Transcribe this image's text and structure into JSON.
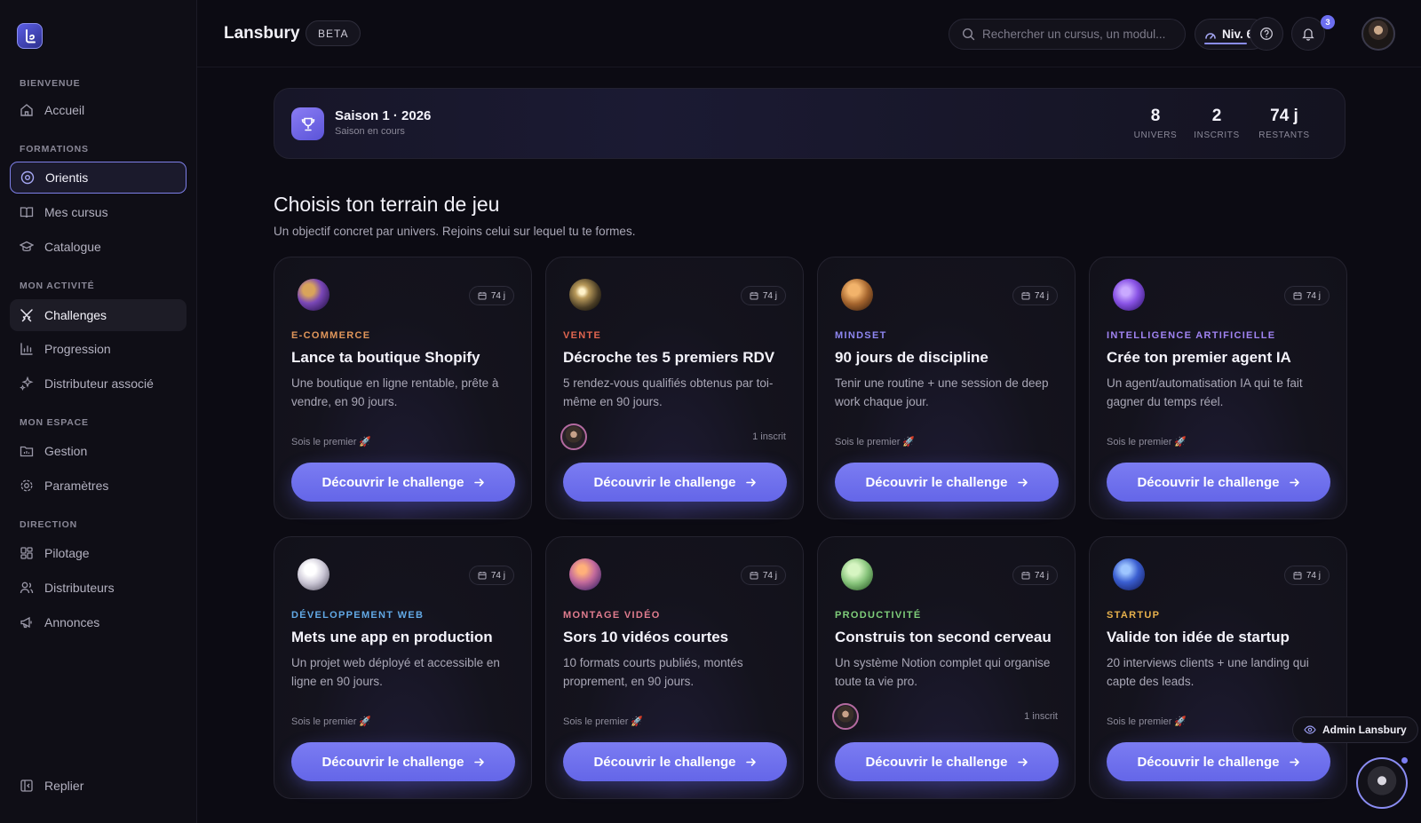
{
  "sidebar": {
    "sections": [
      "BIENVENUE",
      "FORMATIONS",
      "MON ACTIVITÉ",
      "MON ESPACE",
      "DIRECTION"
    ],
    "items": [
      {
        "label": "Accueil",
        "icon": "home-icon"
      },
      {
        "label": "Orientis",
        "icon": "compass-icon"
      },
      {
        "label": "Mes cursus",
        "icon": "book-icon"
      },
      {
        "label": "Catalogue",
        "icon": "graduation-cap-icon"
      },
      {
        "label": "Challenges",
        "icon": "swords-icon"
      },
      {
        "label": "Progression",
        "icon": "bar-chart-icon"
      },
      {
        "label": "Distributeur associé",
        "icon": "sparkles-icon"
      },
      {
        "label": "Gestion",
        "icon": "folder-chart-icon"
      },
      {
        "label": "Paramètres",
        "icon": "settings-icon"
      },
      {
        "label": "Pilotage",
        "icon": "dashboard-icon"
      },
      {
        "label": "Distributeurs",
        "icon": "users-icon"
      },
      {
        "label": "Annonces",
        "icon": "megaphone-icon"
      }
    ],
    "collapse_label": "Replier"
  },
  "header": {
    "brand": "Lansbury",
    "badge": "BETA",
    "search_placeholder": "Rechercher un cursus, un modul...",
    "level": "Niv. 6",
    "notifications": "3"
  },
  "season": {
    "title": "Saison 1 · 2026",
    "subtitle": "Saison en cours",
    "stats": [
      {
        "value": "8",
        "label": "UNIVERS"
      },
      {
        "value": "2",
        "label": "INSCRITS"
      },
      {
        "value": "74 j",
        "label": "RESTANTS"
      }
    ]
  },
  "main": {
    "heading": "Choisis ton terrain de jeu",
    "subheading": "Un objectif concret par univers. Rejoins celui sur lequel tu te formes."
  },
  "cta_label": "Découvrir le challenge",
  "cards": [
    {
      "category": "E-COMMERCE",
      "cat_color": "#e0965a",
      "title": "Lance ta boutique Shopify",
      "description": "Une boutique en ligne rentable, prête à vendre, en 90 jours.",
      "days": "74 j",
      "footer": "Sois le premier 🚀",
      "inscrits": ""
    },
    {
      "category": "VENTE",
      "cat_color": "#e0654f",
      "title": "Décroche tes 5 premiers RDV",
      "description": "5 rendez-vous qualifiés obtenus par toi-même en 90 jours.",
      "days": "74 j",
      "footer": "",
      "inscrits": "1 inscrit"
    },
    {
      "category": "MINDSET",
      "cat_color": "#8e86f0",
      "title": "90 jours de discipline",
      "description": "Tenir une routine + une session de deep work chaque jour.",
      "days": "74 j",
      "footer": "Sois le premier 🚀",
      "inscrits": ""
    },
    {
      "category": "INTELLIGENCE ARTIFICIELLE",
      "cat_color": "#a083f2",
      "title": "Crée ton premier agent IA",
      "description": "Un agent/automatisation IA qui te fait gagner du temps réel.",
      "days": "74 j",
      "footer": "Sois le premier 🚀",
      "inscrits": ""
    },
    {
      "category": "DÉVELOPPEMENT WEB",
      "cat_color": "#62a9e6",
      "title": "Mets une app en production",
      "description": "Un projet web déployé et accessible en ligne en 90 jours.",
      "days": "74 j",
      "footer": "Sois le premier 🚀",
      "inscrits": ""
    },
    {
      "category": "MONTAGE VIDÉO",
      "cat_color": "#e07c8e",
      "title": "Sors 10 vidéos courtes",
      "description": "10 formats courts publiés, montés proprement, en 90 jours.",
      "days": "74 j",
      "footer": "Sois le premier 🚀",
      "inscrits": ""
    },
    {
      "category": "PRODUCTIVITÉ",
      "cat_color": "#7fce7a",
      "title": "Construis ton second cerveau",
      "description": "Un système Notion complet qui organise toute ta vie pro.",
      "days": "74 j",
      "footer": "",
      "inscrits": "1 inscrit"
    },
    {
      "category": "STARTUP",
      "cat_color": "#e7b14c",
      "title": "Valide ton idée de startup",
      "description": "20 interviews clients + une landing qui capte des leads.",
      "days": "74 j",
      "footer": "Sois le premier 🚀",
      "inscrits": ""
    }
  ],
  "admin_label": "Admin Lansbury"
}
